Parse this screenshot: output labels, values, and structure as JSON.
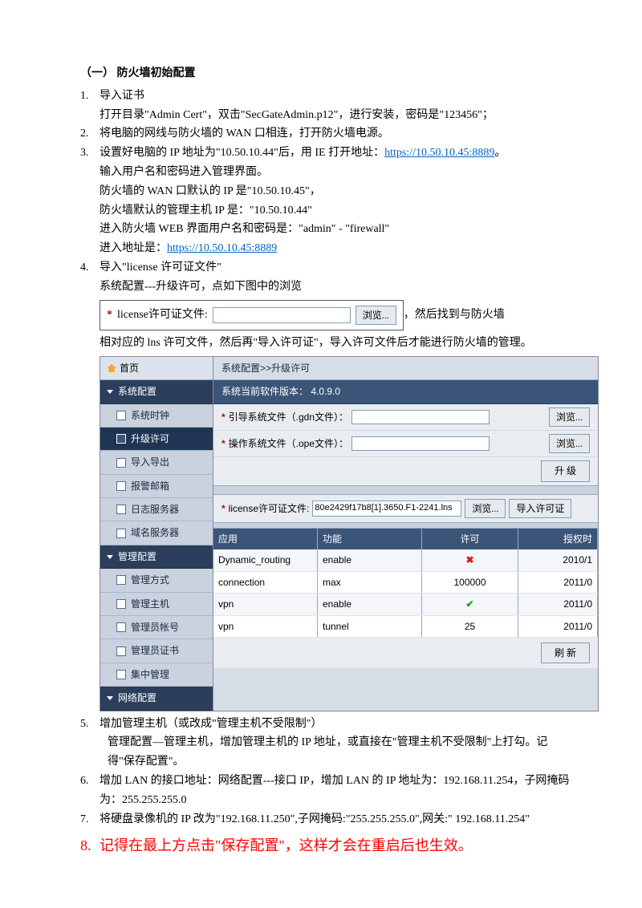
{
  "heading": "（一） 防火墙初始配置",
  "items": {
    "n1": "1.",
    "t1a": "导入证书",
    "t1b": "打开目录\"Admin Cert\"，双击\"SecGateAdmin.p12\"，进行安装，密码是\"123456\"；",
    "n2": "2.",
    "t2": "将电脑的网线与防火墙的 WAN 口相连，打开防火墙电源。",
    "n3": "3.",
    "t3a_before": "设置好电脑的 IP 地址为\"10.50.10.44\"后，用 IE 打开地址：",
    "t3a_link": "https://10.50.10.45:8889",
    "t3a_after": "。",
    "t3b": "输入用户名和密码进入管理界面。",
    "t3c": "防火墙的 WAN 口默认的 IP 是\"10.50.10.45\"，",
    "t3d": "防火墙默认的管理主机 IP 是：\"10.50.10.44\"",
    "t3e": "进入防火墙 WEB 界面用户名和密码是：\"admin\" - \"firewall\"",
    "t3f_before": "进入地址是：",
    "t3f_link": "https://10.50.10.45:8889",
    "n4": "4.",
    "t4a": "导入\"license 许可证文件\"",
    "t4b": "系统配置---升级许可，点如下图中的浏览",
    "license_label": "license许可证文件:",
    "browse_btn": "浏览...",
    "t4c_after": "，然后找到与防火墙",
    "t4d": "相对应的 lns 许可文件，然后再\"导入许可证\"，导入许可文件后才能进行防火墙的管理。",
    "n5": "5.",
    "t5a": "增加管理主机（或改成\"管理主机不受限制\"）",
    "t5b": "管理配置—管理主机，增加管理主机的 IP 地址，或直接在\"管理主机不受限制\"上打勾。记得\"保存配置\"。",
    "n6": "6.",
    "t6": "增加 LAN 的接口地址：网络配置---接口 IP，增加 LAN 的 IP 地址为：192.168.11.254，子网掩码为：255.255.255.0",
    "n7": "7.",
    "t7": "将硬盘录像机的 IP 改为\"192.168.11.250\",子网掩码:\"255.255.255.0\",网关:\" 192.168.11.254\"",
    "n8": "8.",
    "t8": "记得在最上方点击\"保存配置\"，这样才会在重启后也生效。"
  },
  "ui": {
    "home": "首页",
    "sections": {
      "sys": "系统配置",
      "mgr": "管理配置",
      "net": "网络配置"
    },
    "sys_items": [
      "系统时钟",
      "升级许可",
      "导入导出",
      "报警邮箱",
      "日志服务器",
      "域名服务器"
    ],
    "mgr_items": [
      "管理方式",
      "管理主机",
      "管理员帐号",
      "管理员证书",
      "集中管理"
    ],
    "crumb": "系统配置>>升级许可",
    "version": "系统当前软件版本： 4.0.9.0",
    "boot_label": "引导系统文件（.gdn文件）：",
    "ope_label": "操作系统文件（.ope文件）：",
    "upgrade_btn": "升 级",
    "license_label": "license许可证文件:",
    "license_value": "80e2429f17b8[1].3650.F1-2241.lns",
    "import_btn": "导入许可证",
    "th_app": "应用",
    "th_func": "功能",
    "th_lic": "许可",
    "th_auth": "授权时",
    "rows": [
      {
        "app": "Dynamic_routing",
        "func": "enable",
        "lic": "x",
        "auth": "2010/1"
      },
      {
        "app": "connection",
        "func": "max",
        "lic": "100000",
        "auth": "2011/0"
      },
      {
        "app": "vpn",
        "func": "enable",
        "lic": "ok",
        "auth": "2011/0"
      },
      {
        "app": "vpn",
        "func": "tunnel",
        "lic": "25",
        "auth": "2011/0"
      }
    ],
    "refresh_btn": "刷 新"
  }
}
